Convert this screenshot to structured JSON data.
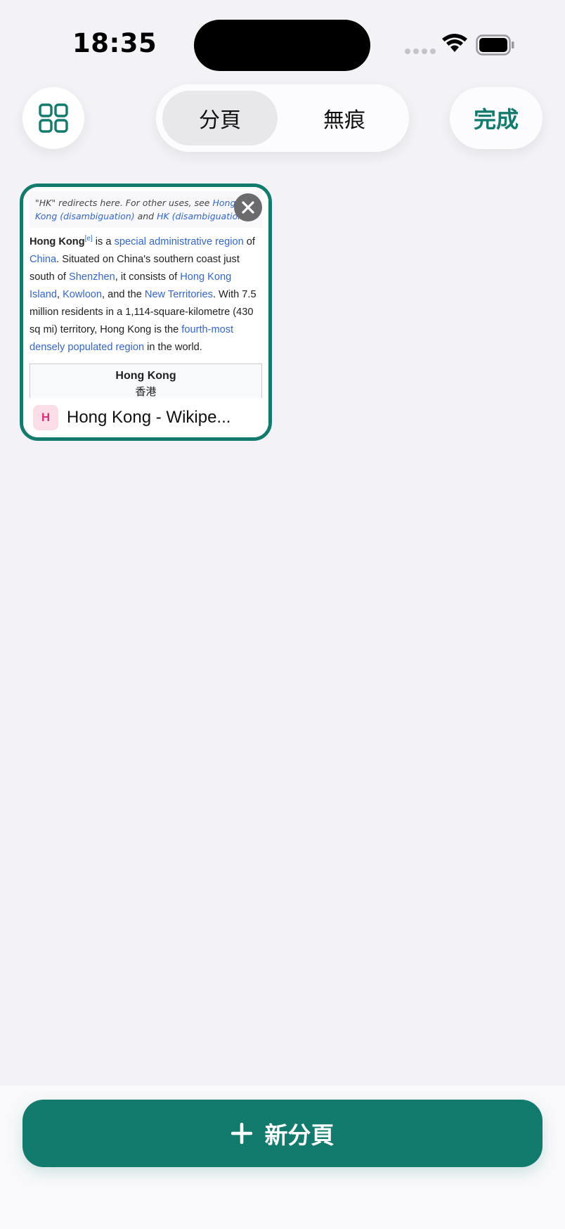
{
  "status_bar": {
    "time": "18:35"
  },
  "toolbar": {
    "segments": [
      {
        "label": "分頁",
        "active": true
      },
      {
        "label": "無痕",
        "active": false
      }
    ],
    "done_label": "完成",
    "accent_color": "#137a6e"
  },
  "tab": {
    "title": "Hong Kong - Wikipe...",
    "favicon_letter": "H",
    "preview": {
      "hatnote_prefix": "\"HK\" redirects here. For other uses, see ",
      "hatnote_link1": "Hong Kong (disambiguation)",
      "hatnote_mid": " and ",
      "hatnote_link2": "HK (disambiguation)",
      "hatnote_end": ".",
      "lead_bold": "Hong Kong",
      "lead_sup": "[e]",
      "t1": " is a ",
      "l1": "special administrative region",
      "t2": " of ",
      "l2": "China",
      "t3": ". Situated on China's southern coast just south of ",
      "l3": "Shenzhen",
      "t4": ", it consists of ",
      "l4": "Hong Kong Island",
      "t5": ", ",
      "l5": "Kowloon",
      "t6": ", and the ",
      "l6": "New Territories",
      "t7": ". With 7.5 million residents in a 1,114-square-kilometre (430 sq mi) territory, Hong Kong is the ",
      "l7": "fourth-most densely populated region",
      "t8": " in the world.",
      "infobox_title": "Hong Kong",
      "infobox_sub": "香港"
    }
  },
  "new_tab_button": {
    "label": "新分頁"
  }
}
